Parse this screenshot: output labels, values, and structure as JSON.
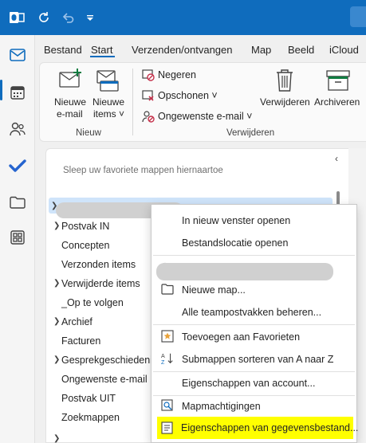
{
  "ribbon_tabs": [
    {
      "label": "Bestand"
    },
    {
      "label": "Start"
    },
    {
      "label": "Verzenden/ontvangen"
    },
    {
      "label": "Map"
    },
    {
      "label": "Beeld"
    },
    {
      "label": "iCloud"
    }
  ],
  "ribbon": {
    "new_email": "Nieuwe",
    "new_email_2": "e-mail",
    "new_items": "Nieuwe",
    "new_items_2": "items ˅",
    "group_new": "Nieuw",
    "ignore": "Negeren",
    "cleanup": "Opschonen ˅",
    "junk": "Ongewenste e-mail ˅",
    "delete": "Verwijderen",
    "archive": "Archiveren",
    "group_delete": "Verwijderen"
  },
  "folder_pane": {
    "favorites_hint": "Sleep uw favoriete mappen hiernaartoe",
    "folders": [
      {
        "label": "Postvak IN"
      },
      {
        "label": "Concepten"
      },
      {
        "label": "Verzonden items"
      },
      {
        "label": "Verwijderde items"
      },
      {
        "label": "_Op te volgen"
      },
      {
        "label": "Archief"
      },
      {
        "label": "Facturen"
      },
      {
        "label": "Gesprekgeschiedenis"
      },
      {
        "label": "Ongewenste e-mail"
      },
      {
        "label": "Postvak UIT"
      },
      {
        "label": "Zoekmappen"
      }
    ]
  },
  "context_menu": {
    "open_new_window": "In nieuw venster openen",
    "open_file_location": "Bestandslocatie openen",
    "new_folder": "Nieuwe map...",
    "manage_team_mailboxes": "Alle teampostvakken beheren...",
    "add_favorites": "Toevoegen aan Favorieten",
    "sort_subfolders": "Submappen sorteren van A naar Z",
    "account_properties": "Eigenschappen van account...",
    "folder_permissions": "Mapmachtigingen",
    "data_file_properties": "Eigenschappen van gegevensbestand..."
  },
  "colors": {
    "accent": "#0f6cbd",
    "selection": "#cfe4fa",
    "highlight": "#ffff00"
  }
}
